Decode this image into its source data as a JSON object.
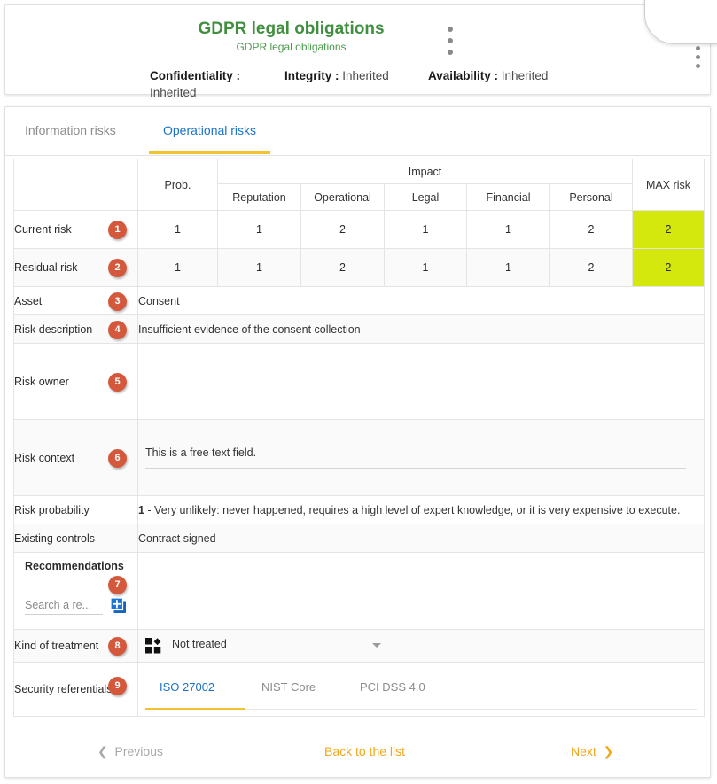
{
  "header": {
    "title": "GDPR legal obligations",
    "subtitle": "GDPR legal obligations",
    "kebab_icon": "more-vertical-icon",
    "cia": [
      {
        "label": "Confidentiality :",
        "value": "Inherited"
      },
      {
        "label": "Integrity :",
        "value": "Inherited"
      },
      {
        "label": "Availability :",
        "value": "Inherited"
      }
    ]
  },
  "corner": {
    "kebab_icon": "more-vertical-icon"
  },
  "risk_tabs": [
    {
      "label": "Information risks",
      "active": false
    },
    {
      "label": "Operational risks",
      "active": true
    }
  ],
  "table": {
    "prob_header": "Prob.",
    "impact_header": "Impact",
    "max_header": "MAX risk",
    "impact_columns": [
      "Reputation",
      "Operational",
      "Legal",
      "Financial",
      "Personal"
    ],
    "rows": [
      {
        "label": "Current risk",
        "badge": "1",
        "prob": "1",
        "impacts": [
          "1",
          "2",
          "1",
          "1",
          "2"
        ],
        "max": "2"
      },
      {
        "label": "Residual risk",
        "badge": "2",
        "prob": "1",
        "impacts": [
          "1",
          "2",
          "1",
          "1",
          "2"
        ],
        "max": "2"
      }
    ],
    "max_risk_color": "#d4e80d"
  },
  "fields": {
    "asset": {
      "label": "Asset",
      "badge": "3",
      "value": "Consent"
    },
    "risk_description": {
      "label": "Risk description",
      "badge": "4",
      "value": "Insufficient evidence of the consent collection"
    },
    "risk_owner": {
      "label": "Risk owner",
      "badge": "5",
      "value": ""
    },
    "risk_context": {
      "label": "Risk context",
      "badge": "6",
      "value": "This is a free text field."
    },
    "risk_probability": {
      "label": "Risk probability",
      "value_bold": "1",
      "value_rest": " - Very unlikely: never happened, requires a high level of expert knowledge, or it is very expensive to execute."
    },
    "existing_controls": {
      "label": "Existing controls",
      "value": "Contract signed"
    },
    "recommendations": {
      "label": "Recommendations",
      "badge": "7",
      "search_placeholder": "Search a re...",
      "add_icon": "add-to-queue-icon"
    },
    "kind_of_treatment": {
      "label": "Kind of treatment",
      "badge": "8",
      "icon": "treatment-blocks-icon",
      "selected": "Not treated",
      "caret_icon": "chevron-down-icon"
    },
    "security_referentials": {
      "label": "Security referentials",
      "badge": "9",
      "tabs": [
        {
          "label": "ISO 27002",
          "active": true
        },
        {
          "label": "NIST Core",
          "active": false
        },
        {
          "label": "PCI DSS 4.0",
          "active": false
        }
      ]
    }
  },
  "footer": {
    "previous": "Previous",
    "back": "Back to the list",
    "next": "Next",
    "prev_icon": "chevron-left-icon",
    "next_icon": "chevron-right-icon"
  },
  "colors": {
    "title_green": "#3f8f3f",
    "badge_orange": "#d4593c",
    "active_tab_blue": "#1a73c8",
    "underline_yellow": "#f2c230",
    "nav_orange": "#f2a71b",
    "max_risk_yellow_green": "#d4e80d"
  }
}
